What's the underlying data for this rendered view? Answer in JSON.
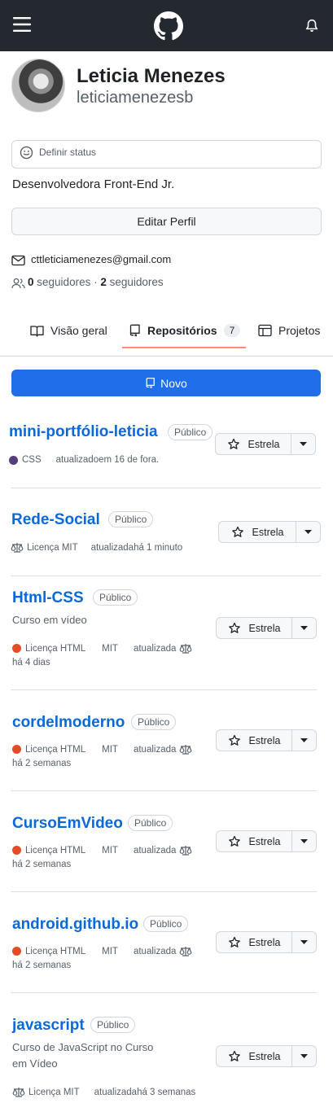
{
  "header": {
    "menu_icon": "hamburger-icon",
    "logo_icon": "github-logo-icon",
    "bell_icon": "bell-icon"
  },
  "profile": {
    "display_name": "Leticia Menezes",
    "username": "leticiamenezesb",
    "status_placeholder": "Definir status",
    "bio": "Desenvolvedora Front-End Jr.",
    "edit_button": "Editar Perfil",
    "email": "cttleticiamenezes@gmail.com",
    "followers_count": "0",
    "followers_label": "seguidores",
    "separator": "·",
    "following_count": "2",
    "following_label": "seguidores"
  },
  "tabs": [
    {
      "label": "Visão geral",
      "icon": "book-icon"
    },
    {
      "label": "Repositórios",
      "icon": "repo-icon",
      "count": "7"
    },
    {
      "label": "Projetos",
      "icon": "table-icon"
    }
  ],
  "new_button": "Novo",
  "star_label": "Estrela",
  "colors": {
    "header_bg": "#24292f",
    "link": "#0969da",
    "primary": "#1f6feb",
    "html_lang": "#e34c26",
    "css_lang": "#563d7c",
    "tab_underline": "#fd8c73"
  },
  "repos": [
    {
      "name": "mini-portfólio-leticia",
      "visibility": "Público",
      "language": "CSS",
      "updated": "atualizadoem 16 de fora."
    },
    {
      "name": "Rede-Social",
      "visibility": "Público",
      "license": "Licença MIT",
      "updated": "atualizadahá 1 minuto"
    },
    {
      "name": "Html-CSS",
      "visibility": "Público",
      "description": "Curso em vídeo",
      "language": "Licença HTML",
      "license": "MIT",
      "updated": "atualizada",
      "updated_when": "há 4 dias"
    },
    {
      "name": "cordelmoderno",
      "visibility": "Público",
      "language": "Licença HTML",
      "license": "MIT",
      "updated": "atualizada",
      "updated_when": "há 2 semanas"
    },
    {
      "name": "CursoEmVideo",
      "visibility": "Público",
      "language": "Licença HTML",
      "license": "MIT",
      "updated": "atualizada",
      "updated_when": "há 2 semanas"
    },
    {
      "name": "android.github.io",
      "visibility": "Público",
      "language": "Licença HTML",
      "license": "MIT",
      "updated": "atualizada",
      "updated_when": "há 2 semanas"
    },
    {
      "name": "javascript",
      "visibility": "Público",
      "description_line1": "Curso de JavaScript no Curso",
      "description_line2": "em Vídeo",
      "license": "Licença MIT",
      "updated": "atualizadahá 3 semanas"
    }
  ]
}
